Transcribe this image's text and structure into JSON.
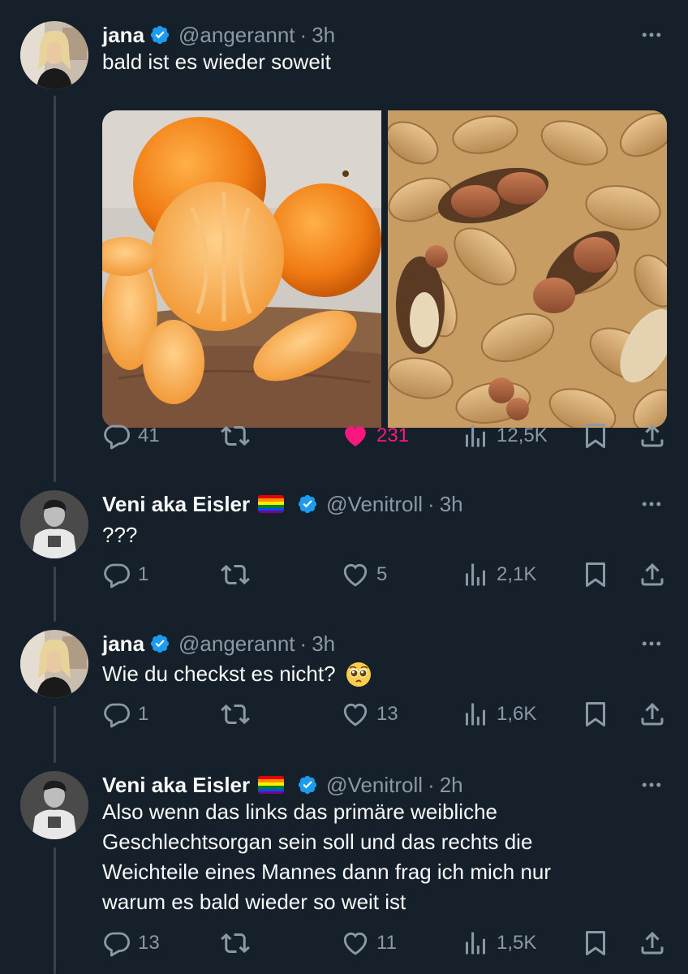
{
  "colors": {
    "background": "#15202b",
    "text_primary": "#f7f9f9",
    "text_secondary": "#8b98a5",
    "verified_blue": "#1d9bf0",
    "like_pink": "#f91880",
    "thread_line": "#38444d"
  },
  "tweets": [
    {
      "name": "jana",
      "handle": "@angerannt",
      "separator": "·",
      "time": "3h",
      "text": "bald ist es wieder soweit",
      "media": [
        "mandarins-image",
        "peanuts-image"
      ],
      "replies": "41",
      "retweets": "",
      "likes": "231",
      "liked": true,
      "views": "12,5K"
    },
    {
      "name": "Veni aka Eisler",
      "flag": "rainbow-flag-emoji",
      "handle": "@Venitroll",
      "separator": "·",
      "time": "3h",
      "text": "???",
      "replies": "1",
      "retweets": "",
      "likes": "5",
      "liked": false,
      "views": "2,1K"
    },
    {
      "name": "jana",
      "handle": "@angerannt",
      "separator": "·",
      "time": "3h",
      "text": "Wie du checkst es nicht?",
      "emoji": "pleading-face-emoji",
      "replies": "1",
      "retweets": "",
      "likes": "13",
      "liked": false,
      "views": "1,6K"
    },
    {
      "name": "Veni aka Eisler",
      "flag": "rainbow-flag-emoji",
      "handle": "@Venitroll",
      "separator": "·",
      "time": "2h",
      "text_lines": [
        "Also wenn das links das primäre weibliche",
        "Geschlechtsorgan sein soll und das rechts die",
        "Weichteile eines Mannes dann frag ich mich nur",
        "warum es bald wieder so weit ist"
      ],
      "replies": "13",
      "retweets": "",
      "likes": "11",
      "liked": false,
      "views": "1,5K"
    }
  ],
  "icons": {
    "reply": "reply-icon",
    "retweet": "retweet-icon",
    "like": "heart-icon",
    "views": "views-icon",
    "bookmark": "bookmark-icon",
    "share": "share-icon",
    "more": "more-icon",
    "verified": "verified-badge-icon"
  }
}
